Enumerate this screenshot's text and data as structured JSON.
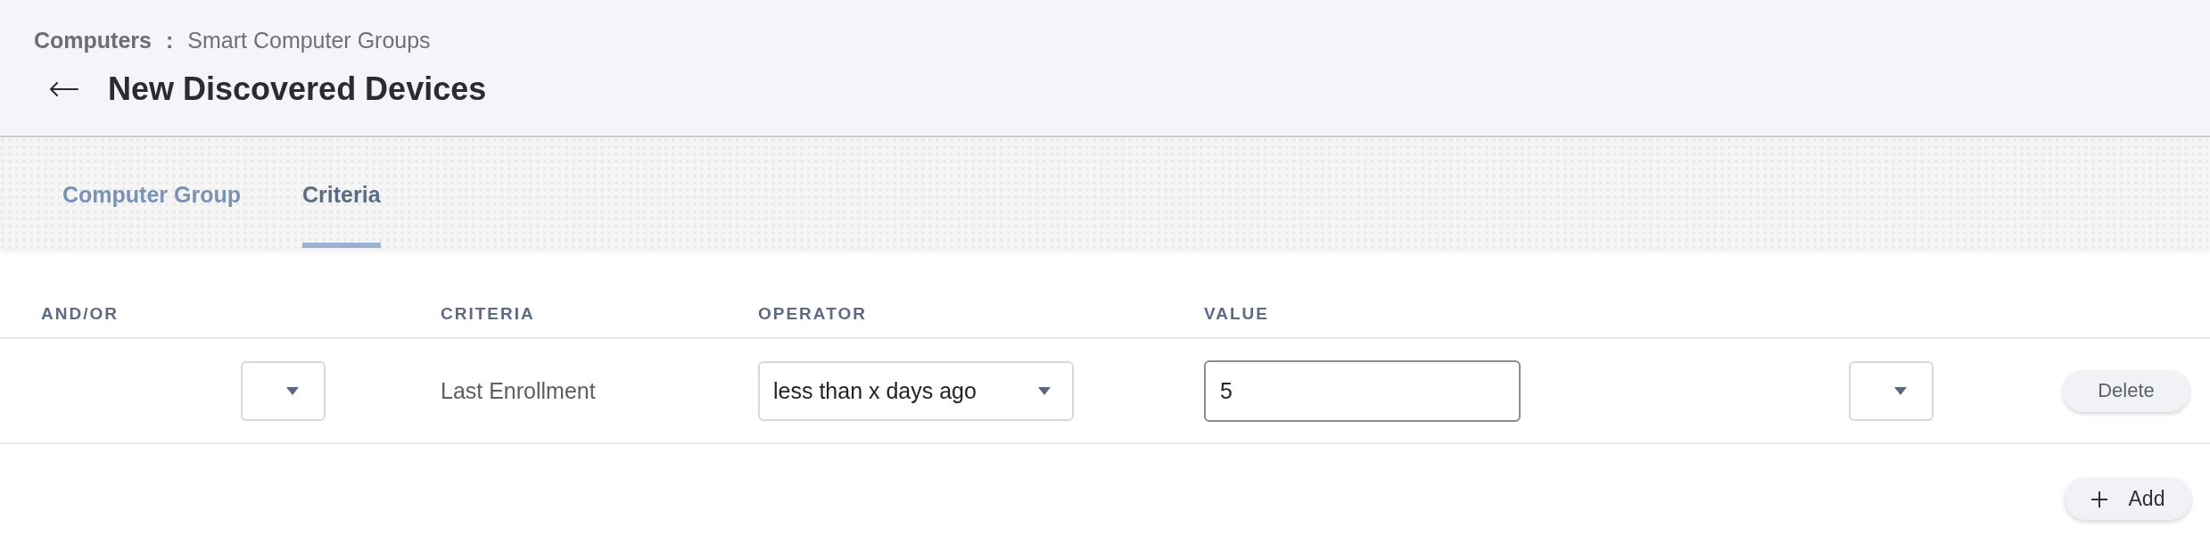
{
  "breadcrumb": {
    "parent": "Computers",
    "separator": ":",
    "current": "Smart Computer Groups"
  },
  "page_title": "New Discovered Devices",
  "tabs": [
    {
      "label": "Computer Group",
      "selected": false
    },
    {
      "label": "Criteria",
      "selected": true
    }
  ],
  "criteria_table": {
    "columns": [
      {
        "label": "AND/OR"
      },
      {
        "label": "CRITERIA"
      },
      {
        "label": "OPERATOR"
      },
      {
        "label": "VALUE"
      }
    ],
    "rows": [
      {
        "criteria": "Last Enrollment",
        "operator": "less than x days ago",
        "value": "5",
        "value_focused": true,
        "delete_label": "Delete"
      }
    ]
  },
  "add_button": {
    "label": "Add"
  }
}
